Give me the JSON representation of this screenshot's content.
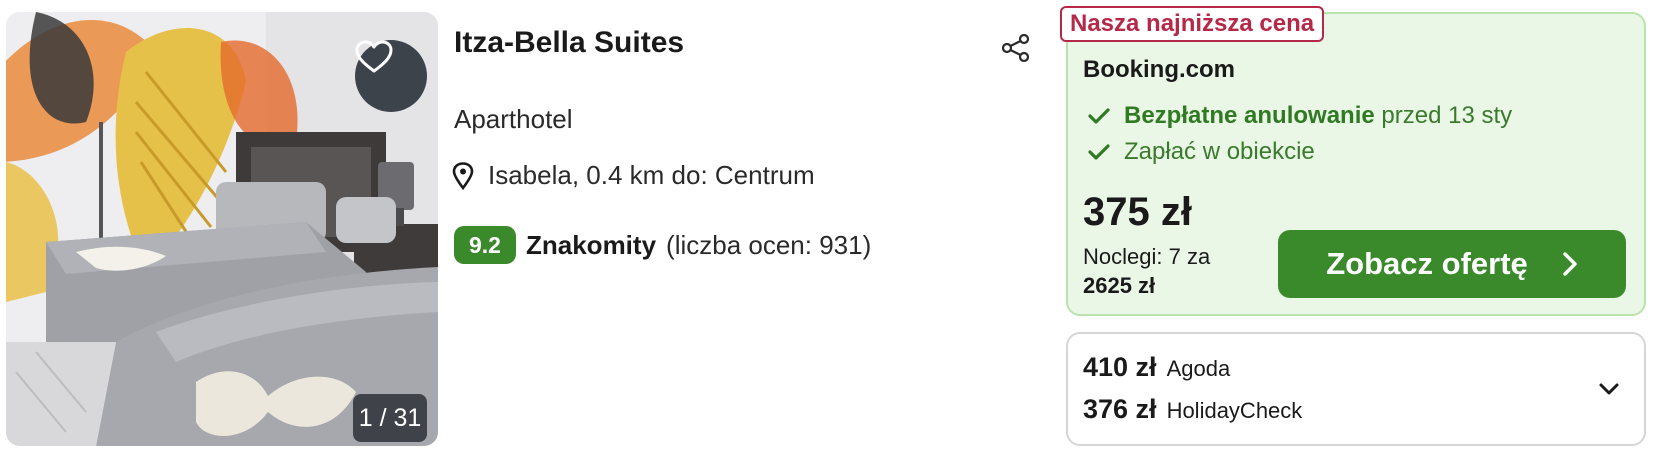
{
  "hotel": {
    "name": "Itza-Bella Suites",
    "type": "Aparthotel",
    "location": "Isabela, 0.4 km do: Centrum",
    "rating": {
      "score": "9.2",
      "label": "Znakomity",
      "count_text": "(liczba ocen: 931)"
    },
    "photo": {
      "counter": "1 / 31",
      "favorite_icon": "heart-outline-icon"
    },
    "share_icon": "share-icon"
  },
  "best_deal": {
    "tag": "Nasza najniższa cena",
    "provider": "Booking.com",
    "features": [
      {
        "bold": "Bezpłatne anulowanie",
        "rest": "przed 13 sty"
      },
      {
        "bold": "",
        "rest": "Zapłać w obiekcie"
      }
    ],
    "price": "375 zł",
    "nights_text": "Noclegi: 7 za",
    "total": "2625 zł",
    "cta_label": "Zobacz ofertę"
  },
  "other_offers": [
    {
      "price": "410 zł",
      "provider": "Agoda"
    },
    {
      "price": "376 zł",
      "provider": "HolidayCheck"
    }
  ],
  "colors": {
    "accent_green": "#3a8a2b",
    "deal_background": "#eaf7e7",
    "lowest_tag": "#b52847"
  }
}
